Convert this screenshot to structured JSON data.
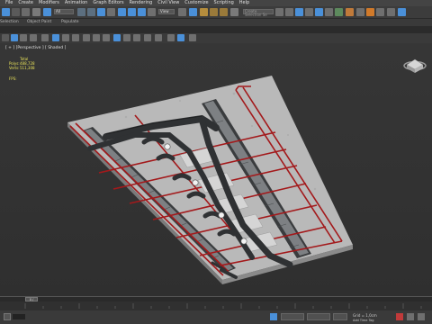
{
  "menubar": {
    "items": [
      "File",
      "Create",
      "Modifiers",
      "Animation",
      "Graph Editors",
      "Rendering",
      "Civil View",
      "Customize",
      "Scripting",
      "Help"
    ]
  },
  "toolbar": {
    "selection_filter": "All",
    "view_dropdown": "View",
    "named_selection_placeholder": "Create Selection Se",
    "ribbon_tabs": [
      "Selection",
      "Object Paint",
      "Populate"
    ]
  },
  "viewport": {
    "label": "[ + ] [Perspective ] [ Shaded ]",
    "stats": {
      "header": "Total",
      "polys_label": "Polys:",
      "polys_value": "488,728",
      "verts_label": "Verts:",
      "verts_value": "511,308"
    },
    "fps_label": "FPS:"
  },
  "timeline": {
    "slider_label": "0 / 100"
  },
  "status": {
    "grid": "Grid = 1,0cm",
    "add_time_tag": "Add Time Tag"
  },
  "colors": {
    "concrete": "#b9b9b9",
    "pipe_dark": "#2f3133",
    "pipe_red": "#a3191b",
    "stats_yellow": "#e8e25a",
    "accent_blue": "#4a90d9"
  }
}
